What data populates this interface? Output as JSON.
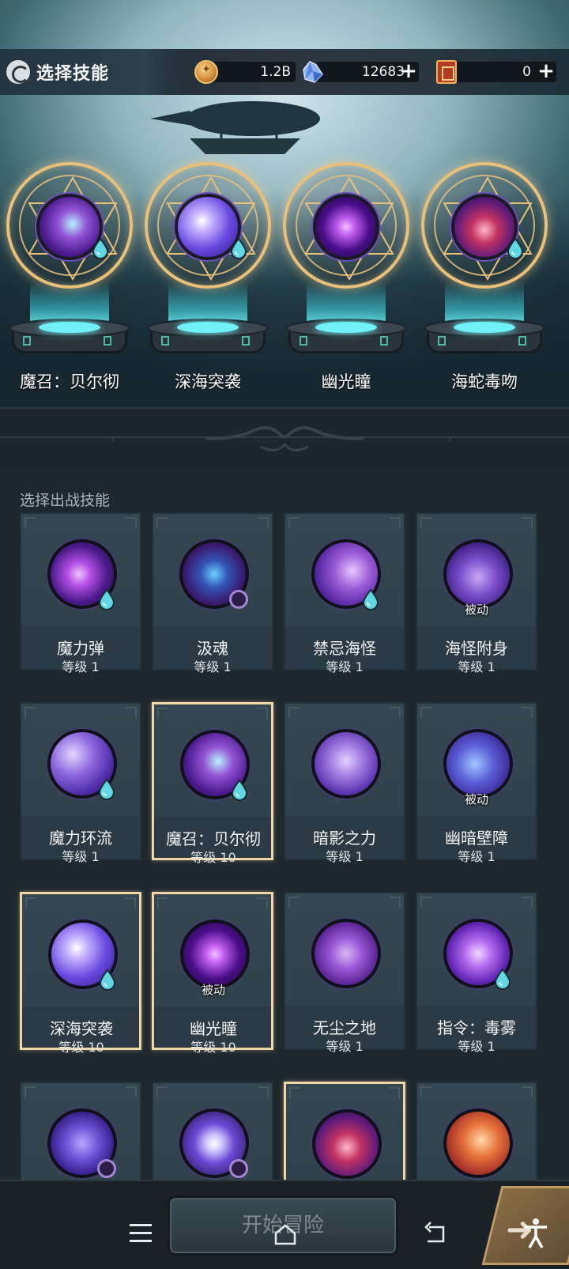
{
  "header": {
    "title": "选择技能",
    "gold": "1.2B",
    "gems": "12683",
    "tickets": "0",
    "plus_symbol": "+"
  },
  "equipped": [
    {
      "name": "魔召：贝尔彻",
      "icon": "sea-monster-icon",
      "element": "water-drop-icon"
    },
    {
      "name": "深海突袭",
      "icon": "star-staff-icon",
      "element": "water-drop-icon"
    },
    {
      "name": "幽光瞳",
      "icon": "purple-eye-icon",
      "element": "none"
    },
    {
      "name": "海蛇毒吻",
      "icon": "sea-serpent-maw-icon",
      "element": "water-drop-icon"
    }
  ],
  "list": {
    "section_label": "选择出战技能",
    "passive_label": "被动",
    "cards": [
      {
        "name": "魔力弹",
        "level": "等级 1",
        "selected": false,
        "passive": false,
        "badge": "drop",
        "icon": "magic-bullet-icon"
      },
      {
        "name": "汲魂",
        "level": "等级 1",
        "selected": false,
        "passive": false,
        "badge": "orb",
        "icon": "soul-drain-icon"
      },
      {
        "name": "禁忌海怪",
        "level": "等级 1",
        "selected": false,
        "passive": false,
        "badge": "drop",
        "icon": "forbidden-kraken-icon"
      },
      {
        "name": "海怪附身",
        "level": "等级 1",
        "selected": false,
        "passive": true,
        "badge": "none",
        "icon": "kraken-possession-icon"
      },
      {
        "name": "魔力环流",
        "level": "等级 1",
        "selected": false,
        "passive": false,
        "badge": "drop",
        "icon": "mana-flow-icon"
      },
      {
        "name": "魔召：贝尔彻",
        "level": "等级 10",
        "selected": true,
        "passive": false,
        "badge": "drop",
        "icon": "sea-monster-icon"
      },
      {
        "name": "暗影之力",
        "level": "等级 1",
        "selected": false,
        "passive": false,
        "badge": "none",
        "icon": "shadow-power-icon"
      },
      {
        "name": "幽暗壁障",
        "level": "等级 1",
        "selected": false,
        "passive": true,
        "badge": "none",
        "icon": "dark-barrier-icon"
      },
      {
        "name": "深海突袭",
        "level": "等级 10",
        "selected": true,
        "passive": false,
        "badge": "drop",
        "icon": "star-staff-icon"
      },
      {
        "name": "幽光瞳",
        "level": "等级 10",
        "selected": true,
        "passive": true,
        "badge": "none",
        "icon": "purple-eye-icon"
      },
      {
        "name": "无尘之地",
        "level": "等级 1",
        "selected": false,
        "passive": false,
        "badge": "none",
        "icon": "dustless-land-icon"
      },
      {
        "name": "指令：毒雾",
        "level": "等级 1",
        "selected": false,
        "passive": false,
        "badge": "drop",
        "icon": "poison-fog-icon"
      },
      {
        "name": "",
        "level": "",
        "selected": false,
        "passive": false,
        "badge": "orb",
        "icon": "void-cube-icon"
      },
      {
        "name": "",
        "level": "",
        "selected": false,
        "passive": false,
        "badge": "orb",
        "icon": "dark-moon-icon"
      },
      {
        "name": "",
        "level": "",
        "selected": true,
        "passive": false,
        "badge": "none",
        "icon": "sea-serpent-maw-icon"
      },
      {
        "name": "",
        "level": "",
        "selected": false,
        "passive": false,
        "badge": "none",
        "icon": "fire-sword-icon"
      }
    ]
  },
  "footer": {
    "start_label": "开始冒险"
  },
  "colors": {
    "selected_border": "#f0d7a6",
    "card_bg": "#2b3a44",
    "water_drop": "#5fd6e0",
    "rune_gold": "#e8c07a"
  }
}
